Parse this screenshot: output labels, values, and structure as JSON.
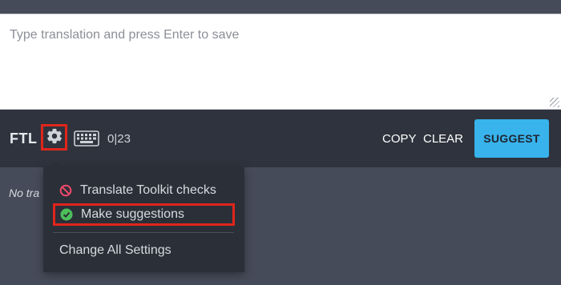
{
  "editor": {
    "placeholder": "Type translation and press Enter to save",
    "value": ""
  },
  "toolbar": {
    "format_label": "FTL",
    "counter": "0|23",
    "copy_label": "COPY",
    "clear_label": "CLEAR",
    "suggest_label": "SUGGEST",
    "icons": [
      "gear-icon",
      "keyboard-icon"
    ]
  },
  "main": {
    "no_translations_text": "No tra"
  },
  "settings_menu": {
    "items": [
      {
        "label": "Translate Toolkit checks",
        "icon": "prohibited-icon",
        "enabled": false
      },
      {
        "label": "Make suggestions",
        "icon": "check-circle-icon",
        "enabled": true
      },
      {
        "label": "Change All Settings"
      }
    ]
  },
  "colors": {
    "accent_blue": "#38b3ec",
    "highlight_red": "#e0251b",
    "check_green": "#4cbf5a",
    "prohibited_pink": "#f2496b",
    "toolbar_bg": "#2f333d",
    "page_bg": "#464b59"
  }
}
